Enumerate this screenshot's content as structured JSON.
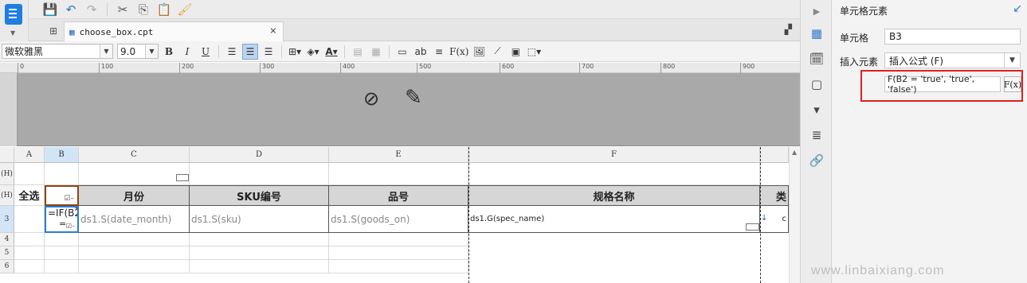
{
  "toolbar": {
    "tab_title": "choose_box.cpt",
    "font_name": "微软雅黑",
    "font_size": "9.0",
    "bold": "B",
    "italic": "I",
    "underline": "U",
    "abc": "ab",
    "fx": "F(x)"
  },
  "ruler": {
    "ticks": [
      "0",
      "100",
      "200",
      "300",
      "400",
      "500",
      "600",
      "700",
      "800",
      "900"
    ]
  },
  "sheet": {
    "columns": [
      "A",
      "B",
      "C",
      "D",
      "E",
      "F"
    ],
    "rows": [
      "(H)",
      "(H)",
      "3",
      "4",
      "5",
      "6"
    ],
    "header_cells": {
      "select_all": "全选",
      "month": "月份",
      "sku": "SKU编号",
      "goods": "品号",
      "spec": "规格名称",
      "extra": "类"
    },
    "b3_line1": "=IF(B2",
    "b3_line2": "=",
    "data_cells": {
      "c3": "ds1.S(date_month)",
      "d3": "ds1.S(sku)",
      "e3": "ds1.S(goods_on)",
      "f3": "ds1.G(spec_name)",
      "g3": "c"
    }
  },
  "panel": {
    "title": "单元格元素",
    "cell_label": "单元格",
    "cell_value": "B3",
    "insert_label": "插入元素",
    "insert_value": "插入公式 (F)",
    "formula_value": "F(B2 = 'true', 'true', 'false')",
    "fx_label": "F(x)"
  },
  "watermark": "www.linbaixiang.com",
  "colors": {
    "accent": "#2f78c8",
    "highlight_box": "#e02020",
    "selected_cell": "#2b7cd3"
  }
}
